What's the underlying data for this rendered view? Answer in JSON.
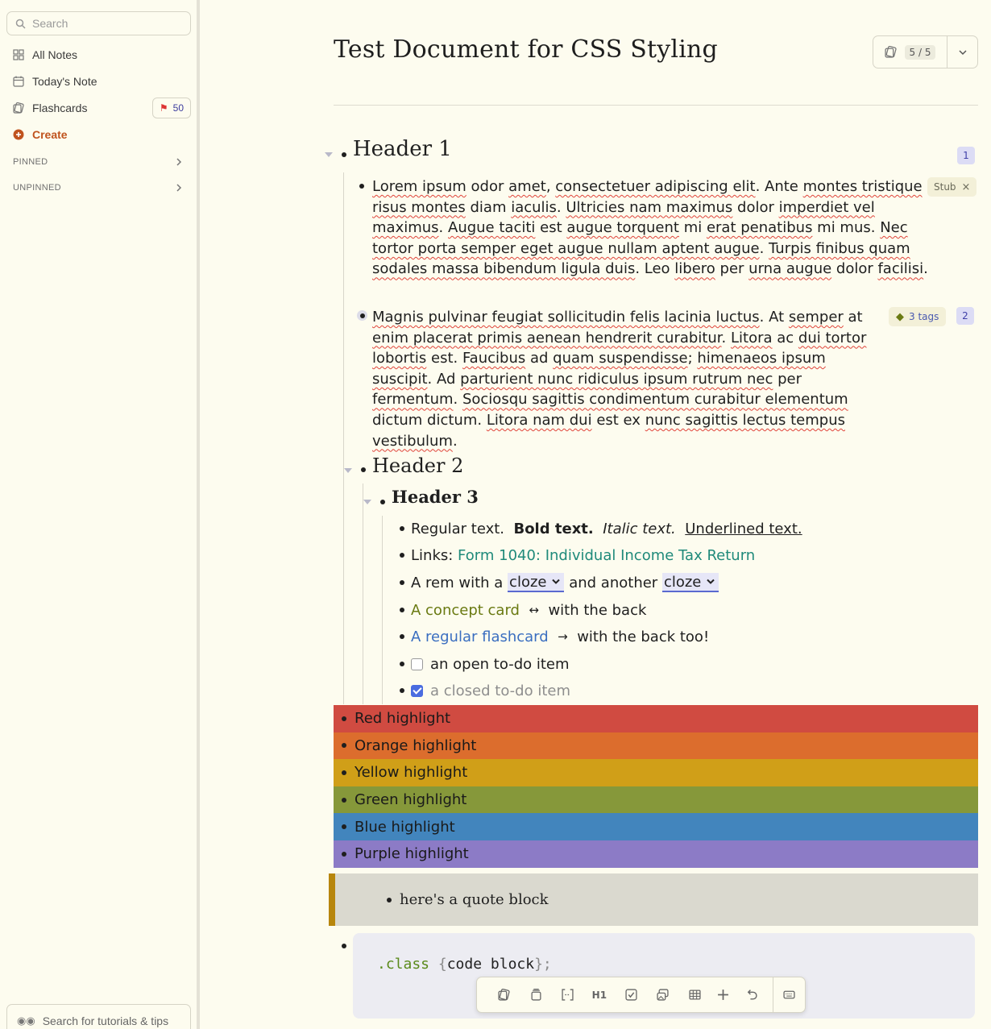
{
  "sidebar": {
    "search_placeholder": "Search",
    "nav": {
      "all_notes": "All Notes",
      "todays_note": "Today's Note",
      "flashcards": "Flashcards",
      "flashcards_badge": "50",
      "create": "Create"
    },
    "sections": {
      "pinned": "PINNED",
      "unpinned": "UNPINNED"
    },
    "tips_placeholder": "Search for tutorials & tips"
  },
  "document": {
    "title": "Test Document for CSS Styling",
    "counter": "5 / 5",
    "header1": "Header 1",
    "header1_badge": "1",
    "header2": "Header 2",
    "header3": "Header 3",
    "stub_tag": "Stub",
    "tags_label": "3 tags",
    "para2_badge": "2",
    "rows": {
      "regular": "Regular text.",
      "bold": "Bold text.",
      "italic": "Italic text.",
      "underline": "Underlined text.",
      "links_label": "Links:",
      "link_text": "Form 1040: Individual Income Tax Return",
      "cloze_prefix": "A rem with a",
      "cloze1": "cloze",
      "cloze_mid": "and another",
      "cloze2": "cloze",
      "concept_front": "A concept card",
      "concept_arrow": "↔",
      "concept_back": "with the back",
      "flash_front": "A regular flashcard",
      "flash_arrow": "→",
      "flash_back": "with the back too!",
      "todo_open": "an open to-do item",
      "todo_closed": "a closed to-do item"
    },
    "highlights": [
      {
        "label": "Red highlight",
        "color": "#d04b41"
      },
      {
        "label": "Orange highlight",
        "color": "#dc6d2d"
      },
      {
        "label": "Yellow highlight",
        "color": "#d09f18"
      },
      {
        "label": "Green highlight",
        "color": "#86983a"
      },
      {
        "label": "Blue highlight",
        "color": "#4285bd"
      },
      {
        "label": "Purple highlight",
        "color": "#8c7bc6"
      }
    ],
    "quote": "here's a quote block",
    "code": {
      "selector": ".class",
      "open": "{",
      "body": "code block",
      "close": "};"
    }
  },
  "toolbar": {
    "heading": "H1"
  }
}
